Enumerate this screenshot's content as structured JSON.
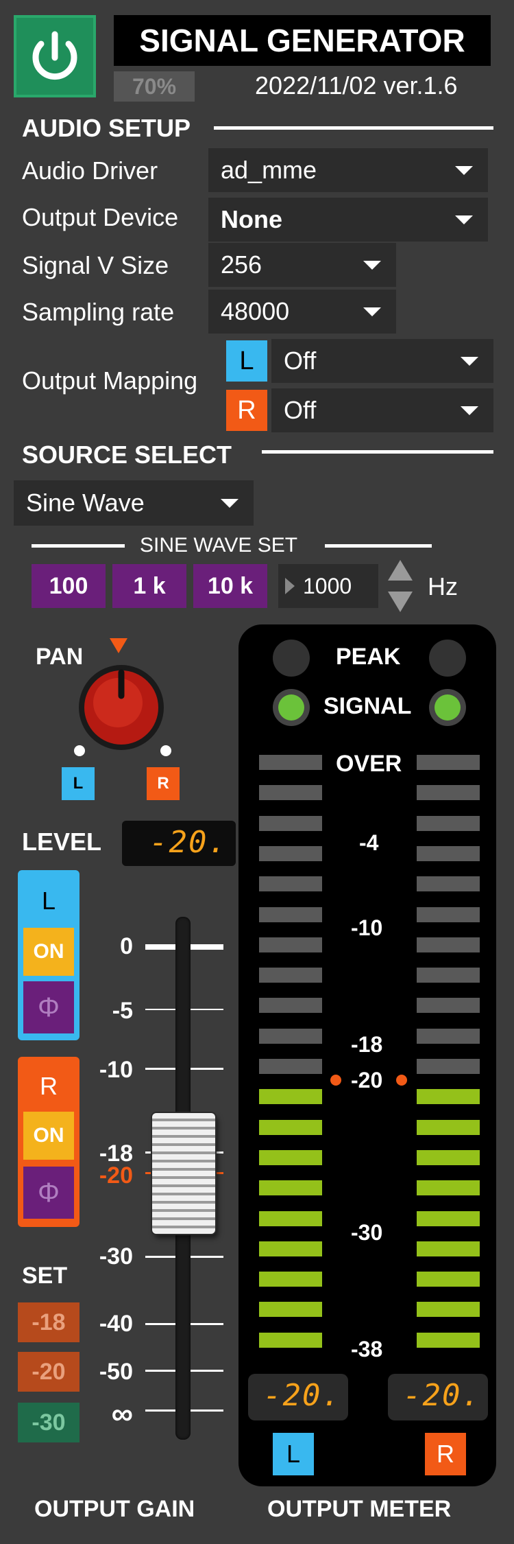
{
  "header": {
    "title": "SIGNAL GENERATOR",
    "volume_percent": "70%",
    "version": "2022/11/02 ver.1.6"
  },
  "audio_setup": {
    "section_label": "AUDIO SETUP",
    "driver_label": "Audio Driver",
    "driver_value": "ad_mme",
    "device_label": "Output Device",
    "device_value": "None",
    "vsize_label": "Signal V Size",
    "vsize_value": "256",
    "rate_label": "Sampling rate",
    "rate_value": "48000",
    "mapping_label": "Output Mapping",
    "map_l_badge": "L",
    "map_l_value": "Off",
    "map_r_badge": "R",
    "map_r_value": "Off"
  },
  "source_select": {
    "section_label": "SOURCE SELECT",
    "source_value": "Sine Wave",
    "sine_set_label": "SINE WAVE SET",
    "preset_100": "100",
    "preset_1k": "1 k",
    "preset_10k": "10 k",
    "frequency_value": "1000",
    "frequency_unit": "Hz"
  },
  "pan": {
    "label": "PAN",
    "left_badge": "L",
    "right_badge": "R"
  },
  "output_gain": {
    "level_label": "LEVEL",
    "level_readout": "-20.",
    "l_label": "L",
    "l_on": "ON",
    "l_phase": "Φ",
    "r_label": "R",
    "r_on": "ON",
    "r_phase": "Φ",
    "set_label": "SET",
    "set_m18": "-18",
    "set_m20": "-20",
    "set_m30": "-30",
    "scale": {
      "s0": "0",
      "s5": "-5",
      "s10": "-10",
      "s18": "-18",
      "s20": "-20",
      "s30": "-30",
      "s40": "-40",
      "s50": "-50",
      "sinf": "∞"
    },
    "footer_label": "OUTPUT GAIN"
  },
  "output_meter": {
    "peak_label": "PEAK",
    "signal_label": "SIGNAL",
    "over_label": "OVER",
    "scale": {
      "m4": "-4",
      "m10": "-10",
      "m18": "-18",
      "m20": "-20",
      "m30": "-30",
      "m38": "-38"
    },
    "l_readout": "-20.",
    "r_readout": "-20.",
    "l_badge": "L",
    "r_badge": "R",
    "footer_label": "OUTPUT METER",
    "segments_total": 20,
    "segments_lit": 9
  },
  "colors": {
    "power_green": "#1f8f5a",
    "l_blue": "#39b8ef",
    "r_orange": "#f25a16",
    "purple": "#6a1f7a",
    "on_amber": "#f4b21c",
    "meter_green": "#94c11a",
    "meter_off": "#595959",
    "readout_amber": "#f7a21b"
  }
}
